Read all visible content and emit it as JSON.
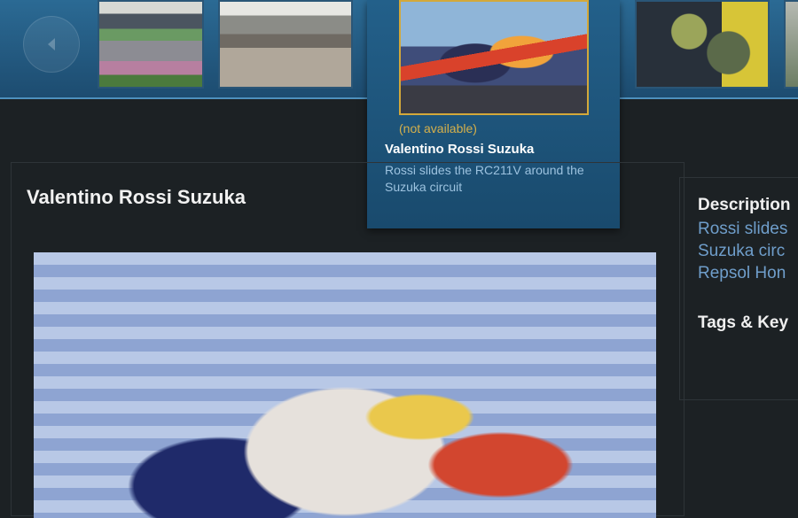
{
  "filmstrip": {
    "prev_icon": "chevron-left-icon",
    "thumbnails": [
      {
        "id": "thumb-racetrack"
      },
      {
        "id": "thumb-landscape"
      },
      {
        "id": "thumb-crowd"
      },
      {
        "id": "thumb-partial"
      }
    ],
    "active_item": {
      "status": "(not available)",
      "title": "Valentino Rossi Suzuka",
      "description": "Rossi slides the RC211V around the Suzuka circuit"
    }
  },
  "main": {
    "title": "Valentino Rossi Suzuka"
  },
  "sidebar": {
    "description_heading": "Description",
    "description_lines": [
      "Rossi slides",
      "Suzuka circ",
      "Repsol Hon"
    ],
    "tags_heading": "Tags & Key"
  },
  "colors": {
    "accent": "#d5b04b",
    "link": "#6f9ecb",
    "background": "#1c2124",
    "strip": "#2b6a94"
  }
}
